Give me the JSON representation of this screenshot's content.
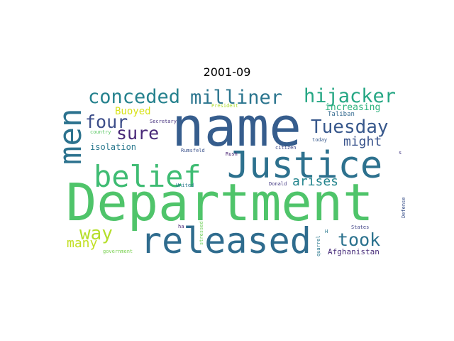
{
  "title": "2001-09",
  "words": [
    {
      "text": "Department",
      "color": "#4fc46a"
    },
    {
      "text": "name",
      "color": "#365d8d"
    },
    {
      "text": "Justice",
      "color": "#2d718e"
    },
    {
      "text": "released",
      "color": "#2f6c8e"
    },
    {
      "text": "belief",
      "color": "#3fbc73"
    },
    {
      "text": "men",
      "color": "#2c728e"
    },
    {
      "text": "conceded",
      "color": "#26828e"
    },
    {
      "text": "milliner",
      "color": "#2b758e"
    },
    {
      "text": "hijacker",
      "color": "#26a784"
    },
    {
      "text": "Tuesday",
      "color": "#38588c"
    },
    {
      "text": "four",
      "color": "#3d4e8a"
    },
    {
      "text": "sure",
      "color": "#482878"
    },
    {
      "text": "way",
      "color": "#b5de2b"
    },
    {
      "text": "took",
      "color": "#2c728e"
    },
    {
      "text": "might",
      "color": "#3a548c"
    },
    {
      "text": "arises",
      "color": "#25858e"
    },
    {
      "text": "many",
      "color": "#c2df23"
    },
    {
      "text": "Buoyed",
      "color": "#d8e219"
    },
    {
      "text": "increasing",
      "color": "#2db27d"
    },
    {
      "text": "isolation",
      "color": "#2a788e"
    },
    {
      "text": "Afghanistan",
      "color": "#472c7a"
    },
    {
      "text": "Taliban",
      "color": "#31688e"
    },
    {
      "text": "President",
      "color": "#addc30"
    },
    {
      "text": "Secretary",
      "color": "#46327e"
    },
    {
      "text": "country",
      "color": "#5ac864"
    },
    {
      "text": "Rumsfeld",
      "color": "#3b528b"
    },
    {
      "text": "Rush",
      "color": "#482173"
    },
    {
      "text": "citizen",
      "color": "#3f4788"
    },
    {
      "text": "today",
      "color": "#38598c"
    },
    {
      "text": "United",
      "color": "#2a788e"
    },
    {
      "text": "Donald",
      "color": "#443a83"
    },
    {
      "text": "stressed",
      "color": "#6ece58"
    },
    {
      "text": "ha",
      "color": "#482475"
    },
    {
      "text": "quarrel",
      "color": "#2a788e"
    },
    {
      "text": "H",
      "color": "#2a788e"
    },
    {
      "text": "States",
      "color": "#414487"
    },
    {
      "text": "Defense",
      "color": "#3b528b"
    },
    {
      "text": "government",
      "color": "#7ad151"
    },
    {
      "text": "s",
      "color": "#443983"
    }
  ]
}
